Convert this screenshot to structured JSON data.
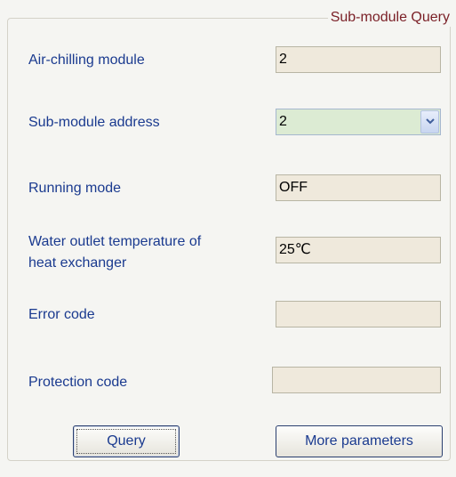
{
  "group": {
    "title": "Sub-module Query"
  },
  "rows": {
    "air_chilling_module": {
      "label": "Air-chilling module",
      "value": "2"
    },
    "sub_module_address": {
      "label": "Sub-module address",
      "value": "2"
    },
    "running_mode": {
      "label": "Running mode",
      "value": "OFF"
    },
    "water_outlet_temp": {
      "label_line1": "Water outlet temperature of",
      "label_line2": "heat exchanger",
      "value": "25℃"
    },
    "error_code": {
      "label": "Error code",
      "value": ""
    },
    "protection_code": {
      "label": "Protection code",
      "value": ""
    }
  },
  "buttons": {
    "query": "Query",
    "more_parameters": "More parameters"
  },
  "icons": {
    "dropdown": "chevron-down-icon"
  }
}
